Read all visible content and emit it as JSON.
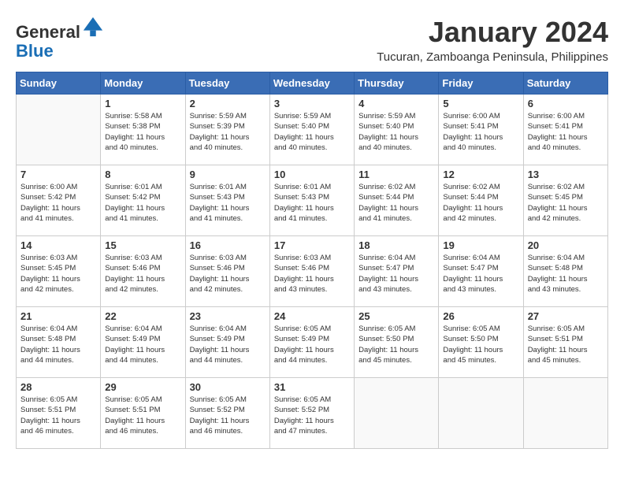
{
  "logo": {
    "general": "General",
    "blue": "Blue"
  },
  "title": "January 2024",
  "subtitle": "Tucuran, Zamboanga Peninsula, Philippines",
  "days_of_week": [
    "Sunday",
    "Monday",
    "Tuesday",
    "Wednesday",
    "Thursday",
    "Friday",
    "Saturday"
  ],
  "weeks": [
    [
      {
        "day": "",
        "info": ""
      },
      {
        "day": "1",
        "info": "Sunrise: 5:58 AM\nSunset: 5:38 PM\nDaylight: 11 hours\nand 40 minutes."
      },
      {
        "day": "2",
        "info": "Sunrise: 5:59 AM\nSunset: 5:39 PM\nDaylight: 11 hours\nand 40 minutes."
      },
      {
        "day": "3",
        "info": "Sunrise: 5:59 AM\nSunset: 5:40 PM\nDaylight: 11 hours\nand 40 minutes."
      },
      {
        "day": "4",
        "info": "Sunrise: 5:59 AM\nSunset: 5:40 PM\nDaylight: 11 hours\nand 40 minutes."
      },
      {
        "day": "5",
        "info": "Sunrise: 6:00 AM\nSunset: 5:41 PM\nDaylight: 11 hours\nand 40 minutes."
      },
      {
        "day": "6",
        "info": "Sunrise: 6:00 AM\nSunset: 5:41 PM\nDaylight: 11 hours\nand 40 minutes."
      }
    ],
    [
      {
        "day": "7",
        "info": "Sunrise: 6:00 AM\nSunset: 5:42 PM\nDaylight: 11 hours\nand 41 minutes."
      },
      {
        "day": "8",
        "info": "Sunrise: 6:01 AM\nSunset: 5:42 PM\nDaylight: 11 hours\nand 41 minutes."
      },
      {
        "day": "9",
        "info": "Sunrise: 6:01 AM\nSunset: 5:43 PM\nDaylight: 11 hours\nand 41 minutes."
      },
      {
        "day": "10",
        "info": "Sunrise: 6:01 AM\nSunset: 5:43 PM\nDaylight: 11 hours\nand 41 minutes."
      },
      {
        "day": "11",
        "info": "Sunrise: 6:02 AM\nSunset: 5:44 PM\nDaylight: 11 hours\nand 41 minutes."
      },
      {
        "day": "12",
        "info": "Sunrise: 6:02 AM\nSunset: 5:44 PM\nDaylight: 11 hours\nand 42 minutes."
      },
      {
        "day": "13",
        "info": "Sunrise: 6:02 AM\nSunset: 5:45 PM\nDaylight: 11 hours\nand 42 minutes."
      }
    ],
    [
      {
        "day": "14",
        "info": "Sunrise: 6:03 AM\nSunset: 5:45 PM\nDaylight: 11 hours\nand 42 minutes."
      },
      {
        "day": "15",
        "info": "Sunrise: 6:03 AM\nSunset: 5:46 PM\nDaylight: 11 hours\nand 42 minutes."
      },
      {
        "day": "16",
        "info": "Sunrise: 6:03 AM\nSunset: 5:46 PM\nDaylight: 11 hours\nand 42 minutes."
      },
      {
        "day": "17",
        "info": "Sunrise: 6:03 AM\nSunset: 5:46 PM\nDaylight: 11 hours\nand 43 minutes."
      },
      {
        "day": "18",
        "info": "Sunrise: 6:04 AM\nSunset: 5:47 PM\nDaylight: 11 hours\nand 43 minutes."
      },
      {
        "day": "19",
        "info": "Sunrise: 6:04 AM\nSunset: 5:47 PM\nDaylight: 11 hours\nand 43 minutes."
      },
      {
        "day": "20",
        "info": "Sunrise: 6:04 AM\nSunset: 5:48 PM\nDaylight: 11 hours\nand 43 minutes."
      }
    ],
    [
      {
        "day": "21",
        "info": "Sunrise: 6:04 AM\nSunset: 5:48 PM\nDaylight: 11 hours\nand 44 minutes."
      },
      {
        "day": "22",
        "info": "Sunrise: 6:04 AM\nSunset: 5:49 PM\nDaylight: 11 hours\nand 44 minutes."
      },
      {
        "day": "23",
        "info": "Sunrise: 6:04 AM\nSunset: 5:49 PM\nDaylight: 11 hours\nand 44 minutes."
      },
      {
        "day": "24",
        "info": "Sunrise: 6:05 AM\nSunset: 5:49 PM\nDaylight: 11 hours\nand 44 minutes."
      },
      {
        "day": "25",
        "info": "Sunrise: 6:05 AM\nSunset: 5:50 PM\nDaylight: 11 hours\nand 45 minutes."
      },
      {
        "day": "26",
        "info": "Sunrise: 6:05 AM\nSunset: 5:50 PM\nDaylight: 11 hours\nand 45 minutes."
      },
      {
        "day": "27",
        "info": "Sunrise: 6:05 AM\nSunset: 5:51 PM\nDaylight: 11 hours\nand 45 minutes."
      }
    ],
    [
      {
        "day": "28",
        "info": "Sunrise: 6:05 AM\nSunset: 5:51 PM\nDaylight: 11 hours\nand 46 minutes."
      },
      {
        "day": "29",
        "info": "Sunrise: 6:05 AM\nSunset: 5:51 PM\nDaylight: 11 hours\nand 46 minutes."
      },
      {
        "day": "30",
        "info": "Sunrise: 6:05 AM\nSunset: 5:52 PM\nDaylight: 11 hours\nand 46 minutes."
      },
      {
        "day": "31",
        "info": "Sunrise: 6:05 AM\nSunset: 5:52 PM\nDaylight: 11 hours\nand 47 minutes."
      },
      {
        "day": "",
        "info": ""
      },
      {
        "day": "",
        "info": ""
      },
      {
        "day": "",
        "info": ""
      }
    ]
  ]
}
